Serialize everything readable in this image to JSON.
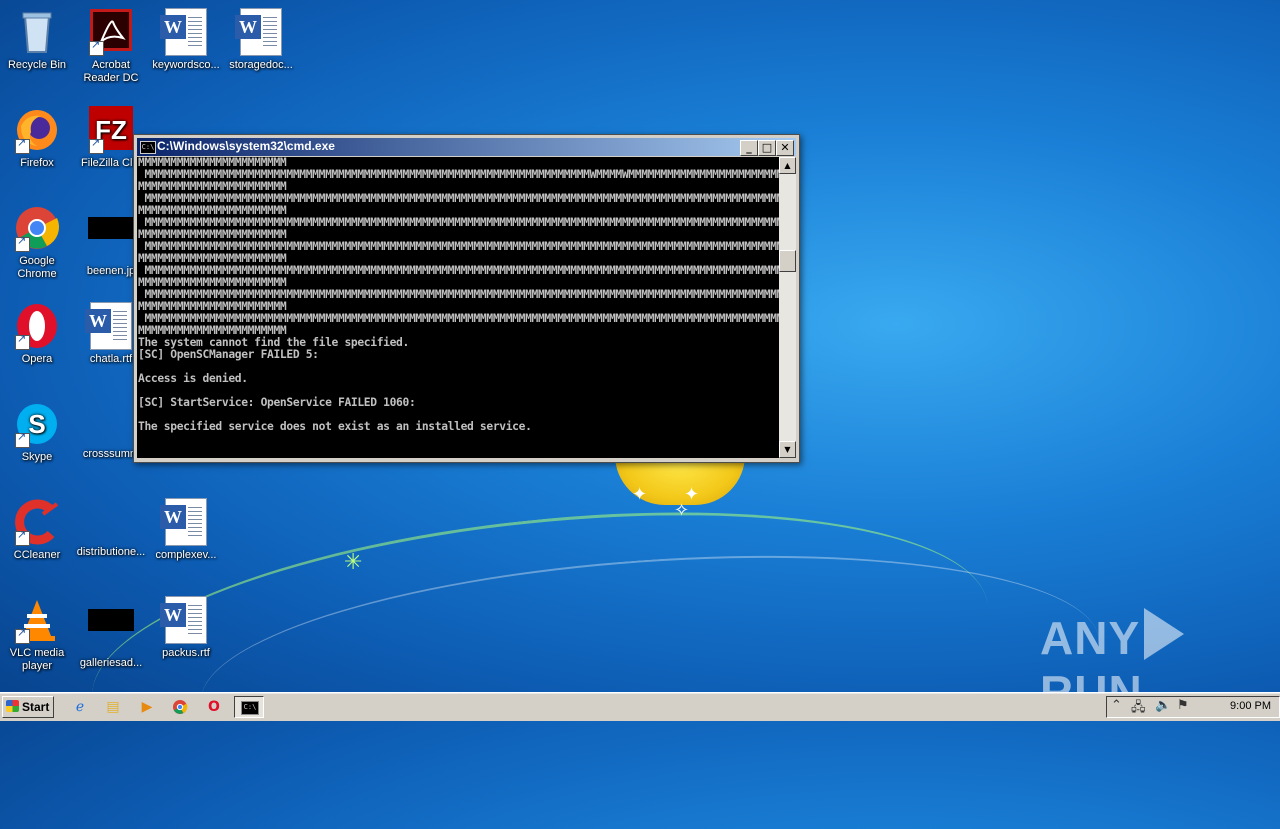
{
  "desktop": {
    "icons": [
      {
        "label": "Recycle Bin",
        "icon": "recycle-bin-icon"
      },
      {
        "label": "Acrobat Reader DC",
        "icon": "acrobat-icon"
      },
      {
        "label": "keywordsco...",
        "icon": "word-doc-icon"
      },
      {
        "label": "storagedoc...",
        "icon": "word-doc-icon"
      },
      {
        "label": "Firefox",
        "icon": "firefox-icon"
      },
      {
        "label": "FileZilla Clie",
        "icon": "filezilla-icon"
      },
      {
        "label": "Google Chrome",
        "icon": "chrome-icon"
      },
      {
        "label": "beenen.jp",
        "icon": "image-file-icon"
      },
      {
        "label": "Opera",
        "icon": "opera-icon"
      },
      {
        "label": "chatla.rtf",
        "icon": "word-doc-icon"
      },
      {
        "label": "Skype",
        "icon": "skype-icon"
      },
      {
        "label": "crosssumm",
        "icon": "file-icon"
      },
      {
        "label": "CCleaner",
        "icon": "ccleaner-icon"
      },
      {
        "label": "distributione...",
        "icon": "file-icon"
      },
      {
        "label": "complexev...",
        "icon": "word-doc-icon"
      },
      {
        "label": "VLC media player",
        "icon": "vlc-icon"
      },
      {
        "label": "galleriesad...",
        "icon": "image-file-icon"
      },
      {
        "label": "packus.rtf",
        "icon": "word-doc-icon"
      }
    ]
  },
  "cmd_window": {
    "title": "C:\\Windows\\system32\\cmd.exe",
    "minimize": "_",
    "maximize": "□",
    "close": "✕",
    "console_lines": [
      "MMMMMMMMMMMMMMMMMMMMMMM",
      " MMMMMMMMMMMMMMMMMMMMMMMMMMMMMMMMMMMMMMMMMMMMMMMMMMMMMMMMMMMMMMMMMMMMMWMMMMWMMMMMMMMMMMMMMMMMMMMMMMMMMMMMMMMMMMMMMMMMMMMMMMMMMMMMMMMMMM",
      "MMMMMMMMMMMMMMMMMMMMMMM",
      " MMMMMMMMMMMMMMMMMMMMMMMMMMMMMMMMMMMMMMMMMMMMMMMMMMMMMMMMMMMMMMMMMMMMMMMMMMMMMMMMMMMMMMMMMMMMMMMMMMMMMMMMMMMMMMMMMMMMMMMMMMMMMMMMMMMMMMMM",
      "MMMMMMMMMMMMMMMMMMMMMMM",
      " MMMMMMMMMMMMMMMMMMMMMMMMMMMMMMMMMMMMMMMMMMMMMMMMMMMMMMMMMMMMMMMMMMMMMMMMMMMMMMMMMMMMMMMMMMMMMMMMMMMMMMMMMMMMMMMMMMMMMMMMMMMMMMMMMMMMMMMM",
      "MMMMMMMMMMMMMMMMMMMMMMM",
      " MMMMMMMMMMMMMMMMMMMMMMMMMMMMMMMMMMMMMMMMMMMMMMMMMMMMMMMMMMMMMMMMMMMMMMMMMMMMMMMMMMMMMMMMMMMMMMMMMMMMMMMMMMMMMMMMMMMMMMMMMMMMMMMMMMMMMMMM",
      "MMMMMMMMMMMMMMMMMMMMMMM",
      " MMMMMMMMMMMMMMMMMMMMMMMMMMMMMMMMMMMMMMMMMMMMMMMMMMMMMMMMMMMMMMMMMMMMMMMMMMMMMMMMMMMMMMMMMMMMMMMMMMMMMMMMMMMMMMMMMMMMMMMMMMMMMMMMMMMMMMMM",
      "MMMMMMMMMMMMMMMMMMMMMMM",
      " MMMMMMMMMMMMMMMMMMMMMMMMMMMMMMMMMMMMMMMMMMMMMMMMMMMMMMMMMMMMMMMMMMMMMMMMMMMMMMMMMMMMMMMMMMMMMMMMMMMMMMMMMMMMMMMMMMMMMMMMMMMMMMMMMMMMMMMM",
      "MMMMMMMMMMMMMMMMMMMMMMM",
      " MMMMMMMMMMMMMMMMMMMMMMMMMMMMMMMMMMMMMMMMMMMMMMMMMMMMMMMMMMMMMMMMMMMMMMMMMMMMMMMMMMMMMMMMMMMMMMMMMMMMMMMMMMMMMMMMMMMMMMMMMMMMMMMMMMMMMMMM",
      "MMMMMMMMMMMMMMMMMMMMMMM",
      "The system cannot find the file specified.",
      "[SC] OpenSCManager FAILED 5:",
      "",
      "Access is denied.",
      "",
      "[SC] StartService: OpenService FAILED 1060:",
      "",
      "The specified service does not exist as an installed service.",
      "",
      ""
    ]
  },
  "taskbar": {
    "start_label": "Start",
    "pinned": [
      "ie-icon",
      "explorer-icon",
      "media-player-icon",
      "chrome-icon",
      "opera-icon",
      "cmd-icon"
    ],
    "clock": "9:00 PM"
  },
  "watermark": {
    "left": "ANY",
    "right": "RUN"
  }
}
